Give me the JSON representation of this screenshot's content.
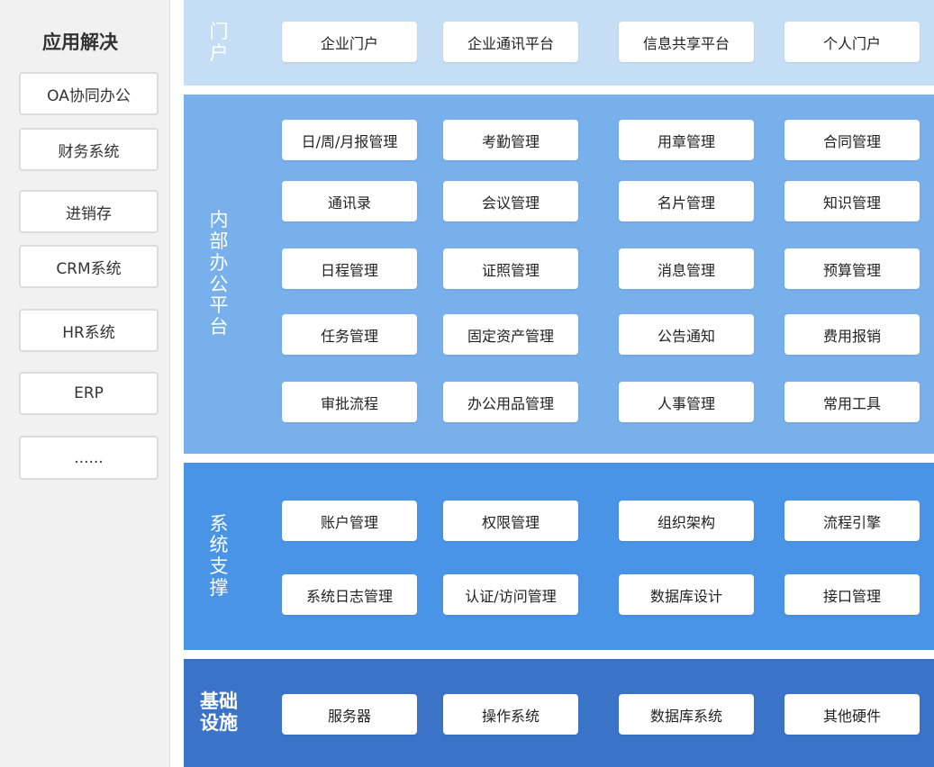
{
  "sidebar": {
    "title": "应用解决",
    "items": [
      "OA协同办公",
      "财务系统",
      "进销存",
      "CRM系统",
      "HR系统",
      "ERP",
      "......"
    ]
  },
  "layers": {
    "portal": {
      "label": "门户",
      "color": "#c5ddf5",
      "modules": [
        "企业门户",
        "企业通讯平台",
        "信息共享平台",
        "个人门户"
      ]
    },
    "office": {
      "label": "内部办公平台",
      "color": "#78b0ec",
      "modules": [
        "日/周/月报管理",
        "考勤管理",
        "用章管理",
        "合同管理",
        "通讯录",
        "会议管理",
        "名片管理",
        "知识管理",
        "日程管理",
        "证照管理",
        "消息管理",
        "预算管理",
        "任务管理",
        "固定资产管理",
        "公告通知",
        "费用报销",
        "审批流程",
        "办公用品管理",
        "人事管理",
        "常用工具"
      ]
    },
    "support": {
      "label": "系统支撑",
      "color": "#4a94e8",
      "modules": [
        "账户管理",
        "权限管理",
        "组织架构",
        "流程引擎",
        "系统日志管理",
        "认证/访问管理",
        "数据库设计",
        "接口管理"
      ]
    },
    "infra": {
      "label": "基础设施",
      "color": "#3a73c8",
      "modules": [
        "服务器",
        "操作系统",
        "数据库系统",
        "其他硬件"
      ]
    }
  }
}
